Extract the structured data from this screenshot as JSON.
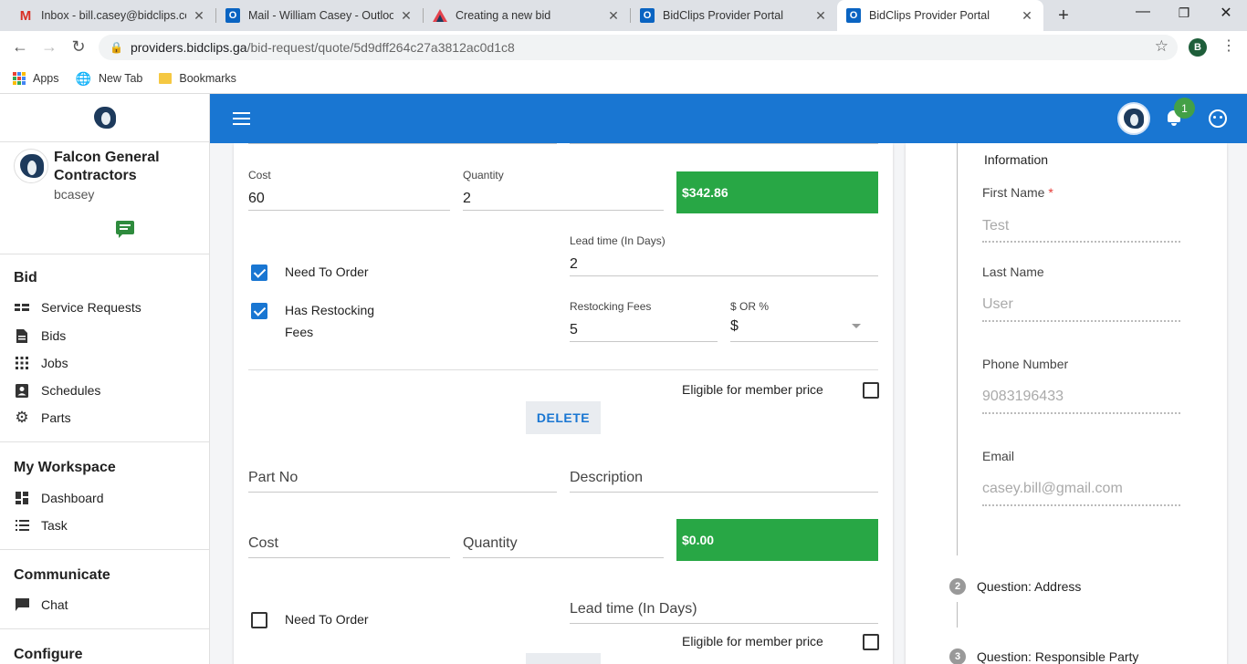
{
  "browser": {
    "tabs": [
      {
        "title": "Inbox - bill.casey@bidclips.com",
        "icon": "gmail-icon"
      },
      {
        "title": "Mail - William Casey - Outlook",
        "icon": "outlook-icon"
      },
      {
        "title": "Creating a new bid",
        "icon": "triangle-logo-icon"
      },
      {
        "title": "BidClips Provider Portal",
        "icon": "outlook-icon"
      },
      {
        "title": "BidClips Provider Portal",
        "icon": "outlook-icon"
      }
    ],
    "url_host": "providers.bidclips.ga",
    "url_path": "/bid-request/quote/5d9dff264c27a3812ac0d1c8",
    "profile_initial": "B",
    "bookmarks": [
      {
        "label": "Apps"
      },
      {
        "label": "New Tab"
      },
      {
        "label": "Bookmarks"
      }
    ]
  },
  "sidebar": {
    "company_name": "Falcon General Contractors",
    "username": "bcasey",
    "sections": [
      {
        "heading": "Bid",
        "items": [
          "Service Requests",
          "Bids",
          "Jobs",
          "Schedules",
          "Parts"
        ]
      },
      {
        "heading": "My Workspace",
        "items": [
          "Dashboard",
          "Task"
        ]
      },
      {
        "heading": "Communicate",
        "items": [
          "Chat"
        ]
      },
      {
        "heading": "Configure",
        "items": []
      }
    ]
  },
  "header": {
    "notification_count": "1"
  },
  "part1": {
    "cost_label": "Cost",
    "cost_value": "60",
    "qty_label": "Quantity",
    "qty_value": "2",
    "total": "$342.86",
    "need_to_order_label": "Need To Order",
    "need_to_order_checked": true,
    "lead_time_label": "Lead time (In Days)",
    "lead_time_value": "2",
    "has_restocking_label_1": "Has Restocking",
    "has_restocking_label_2": "Fees",
    "has_restocking_checked": true,
    "restocking_fees_label": "Restocking Fees",
    "restocking_fees_value": "5",
    "fee_type_label": "$ OR %",
    "fee_type_value": "$",
    "member_price_label": "Eligible for member price",
    "member_price_checked": false,
    "delete_label": "DELETE"
  },
  "part2": {
    "part_no_placeholder": "Part No",
    "description_placeholder": "Description",
    "cost_placeholder": "Cost",
    "qty_placeholder": "Quantity",
    "total": "$0.00",
    "need_to_order_label": "Need To Order",
    "need_to_order_checked": false,
    "lead_time_placeholder": "Lead time (In Days)",
    "member_price_label": "Eligible for member price",
    "member_price_checked": false
  },
  "info_panel": {
    "section_title": "Information",
    "first_name_label": "First Name",
    "required_mark": "*",
    "first_name_value": "Test",
    "last_name_label": "Last Name",
    "last_name_value": "User",
    "phone_label": "Phone Number",
    "phone_value": "9083196433",
    "email_label": "Email",
    "email_value": "casey.bill@gmail.com",
    "steps": [
      {
        "number": "2",
        "label": "Question: Address"
      },
      {
        "number": "3",
        "label": "Question: Responsible Party"
      }
    ]
  }
}
